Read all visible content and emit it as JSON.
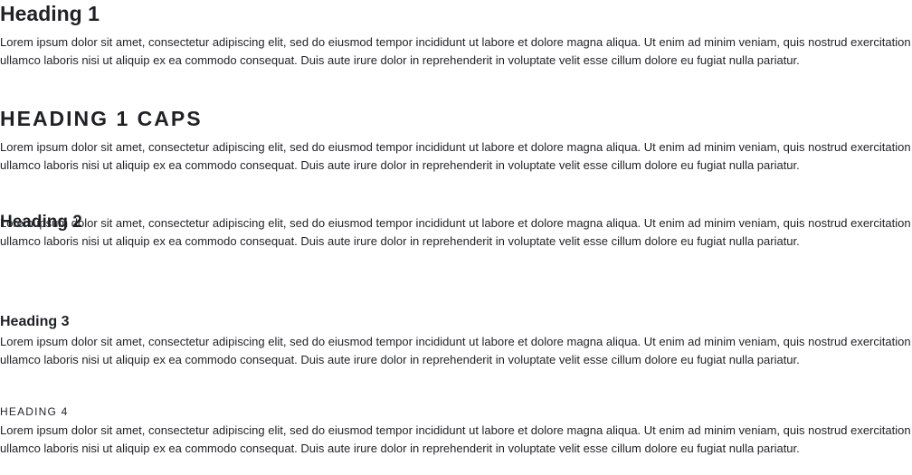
{
  "sections": [
    {
      "heading": "Heading 1",
      "paragraph": "Lorem ipsum dolor sit amet, consectetur adipiscing elit, sed do eiusmod tempor incididunt ut labore et dolore magna aliqua. Ut enim ad minim veniam, quis nostrud exercitation ullamco laboris nisi ut aliquip ex ea commodo consequat. Duis aute irure dolor in reprehenderit in voluptate velit esse cillum dolore eu fugiat nulla pariatur."
    },
    {
      "heading": "Heading 1 Caps",
      "paragraph": "Lorem ipsum dolor sit amet, consectetur adipiscing elit, sed do eiusmod tempor incididunt ut labore et dolore magna aliqua. Ut enim ad minim veniam, quis nostrud exercitation ullamco laboris nisi ut aliquip ex ea commodo consequat. Duis aute irure dolor in reprehenderit in voluptate velit esse cillum dolore eu fugiat nulla pariatur."
    },
    {
      "heading": "Heading 2",
      "paragraph": "Lorem ipsum dolor sit amet, consectetur adipiscing elit, sed do eiusmod tempor incididunt ut labore et dolore magna aliqua. Ut enim ad minim veniam, quis nostrud exercitation ullamco laboris nisi ut aliquip ex ea commodo consequat. Duis aute irure dolor in reprehenderit in voluptate velit esse cillum dolore eu fugiat nulla pariatur."
    },
    {
      "heading": "Heading 3",
      "paragraph": "Lorem ipsum dolor sit amet, consectetur adipiscing elit, sed do eiusmod tempor incididunt ut labore et dolore magna aliqua. Ut enim ad minim veniam, quis nostrud exercitation ullamco laboris nisi ut aliquip ex ea commodo consequat. Duis aute irure dolor in reprehenderit in voluptate velit esse cillum dolore eu fugiat nulla pariatur."
    },
    {
      "heading": "Heading 4",
      "paragraph": "Lorem ipsum dolor sit amet, consectetur adipiscing elit, sed do eiusmod tempor incididunt ut labore et dolore magna aliqua. Ut enim ad minim veniam, quis nostrud exercitation ullamco laboris nisi ut aliquip ex ea commodo consequat. Duis aute irure dolor in reprehenderit in voluptate velit esse cillum dolore eu fugiat nulla pariatur."
    }
  ],
  "colors": {
    "text": "#1f2124",
    "background": "#ffffff"
  }
}
